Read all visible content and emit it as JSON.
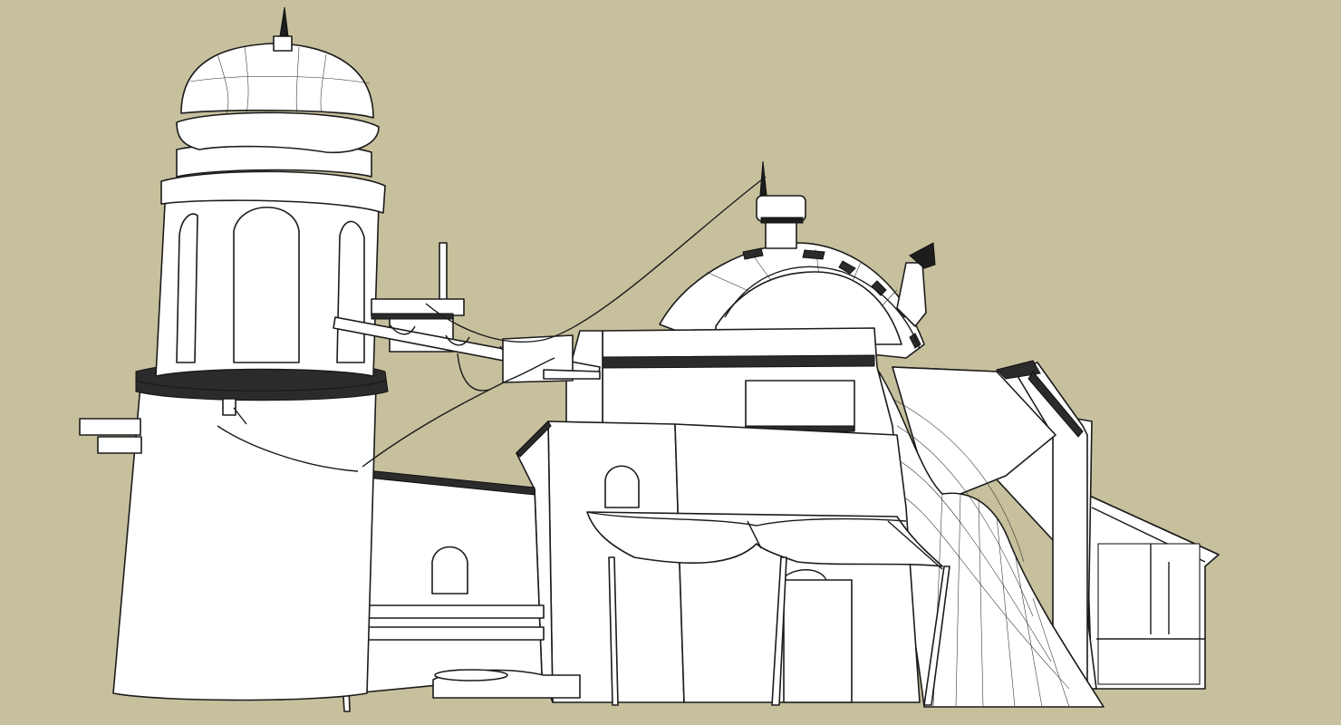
{
  "scene": {
    "background_color": "#c7c09d",
    "wire_color": "#1b1b1b",
    "surface_color": "#ffffff"
  }
}
